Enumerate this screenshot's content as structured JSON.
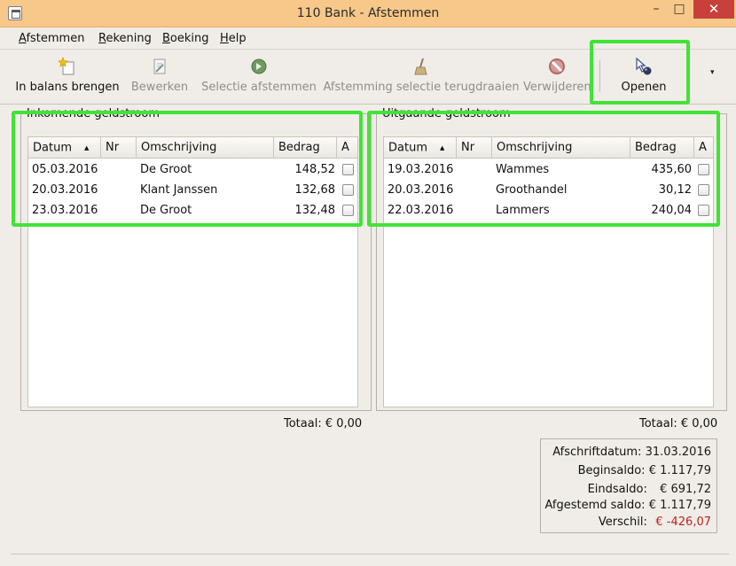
{
  "window": {
    "title": "110 Bank - Afstemmen",
    "minimize_glyph": "–",
    "maximize_glyph": "□",
    "close_glyph": "✕"
  },
  "menu": {
    "items": [
      {
        "mnemonic": "A",
        "rest": "fstemmen"
      },
      {
        "mnemonic": "R",
        "rest": "ekening"
      },
      {
        "mnemonic": "B",
        "rest": "oeking"
      },
      {
        "mnemonic": "H",
        "rest": "elp"
      }
    ]
  },
  "toolbar": {
    "items": [
      {
        "label": "In balans brengen",
        "icon": "new-star-icon",
        "enabled": true
      },
      {
        "label": "Bewerken",
        "icon": "edit-document-icon",
        "enabled": false
      },
      {
        "label": "Selectie afstemmen",
        "icon": "green-arrow-icon",
        "enabled": false
      },
      {
        "label": "Afstemming selectie terugdraaien",
        "icon": "broom-icon",
        "enabled": false
      },
      {
        "label": "Verwijderen",
        "icon": "delete-circle-icon",
        "enabled": false
      },
      {
        "label": "Openen",
        "icon": "open-cursor-icon",
        "enabled": true
      }
    ],
    "overflow_glyph": "▾"
  },
  "incoming": {
    "legend": "Inkomende geldstroom",
    "columns": [
      "Datum",
      "Nr",
      "Omschrijving",
      "Bedrag",
      "A"
    ],
    "rows": [
      {
        "date": "05.03.2016",
        "nr": "",
        "desc": "De Groot",
        "amount": "148,52",
        "checked": false
      },
      {
        "date": "20.03.2016",
        "nr": "",
        "desc": "Klant Janssen",
        "amount": "132,68",
        "checked": false
      },
      {
        "date": "23.03.2016",
        "nr": "",
        "desc": "De Groot",
        "amount": "132,48",
        "checked": false
      }
    ],
    "total": "Totaal: € 0,00"
  },
  "outgoing": {
    "legend": "Uitgaande geldstroom",
    "columns": [
      "Datum",
      "Nr",
      "Omschrijving",
      "Bedrag",
      "A"
    ],
    "rows": [
      {
        "date": "19.03.2016",
        "nr": "",
        "desc": "Wammes",
        "amount": "435,60",
        "checked": false
      },
      {
        "date": "20.03.2016",
        "nr": "",
        "desc": "Groothandel",
        "amount": "30,12",
        "checked": false
      },
      {
        "date": "22.03.2016",
        "nr": "",
        "desc": "Lammers",
        "amount": "240,04",
        "checked": false
      }
    ],
    "total": "Totaal: € 0,00"
  },
  "summary": {
    "rows": [
      {
        "key": "Afschriftdatum:",
        "value": "31.03.2016",
        "negative": false
      },
      {
        "key": "Beginsaldo:",
        "value": "€ 1.117,79",
        "negative": false
      },
      {
        "key": "Eindsaldo:",
        "value": "€ 691,72",
        "negative": false
      },
      {
        "key": "Afgestemd saldo:",
        "value": "€ 1.117,79",
        "negative": false
      },
      {
        "key": "Verschil:",
        "value": "€ -426,07",
        "negative": true
      }
    ]
  },
  "colors": {
    "titlebar": "#f7c889",
    "highlight": "#41e336",
    "negative": "#c0221c"
  }
}
